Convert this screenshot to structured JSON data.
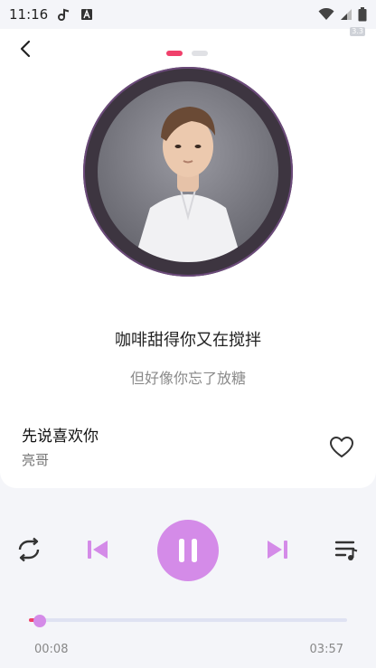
{
  "status_bar": {
    "time": "11:16",
    "left_icons": [
      "music-note-icon",
      "font-a-icon"
    ],
    "right_icons": [
      "wifi-icon",
      "signal-icon",
      "battery-icon"
    ]
  },
  "header": {
    "back_icon": "chevron-left-icon",
    "page_indicator": {
      "count": 2,
      "active": 0,
      "active_color": "#f0406b"
    },
    "corner_badge": "3.3"
  },
  "album_art": {
    "description_icon": "album-disc"
  },
  "lyrics": {
    "current": "咖啡甜得你又在搅拌",
    "next": "但好像你忘了放糖"
  },
  "song": {
    "title": "先说喜欢你",
    "artist": "亮哥",
    "favorite_icon": "heart-outline-icon"
  },
  "controls": {
    "repeat_icon": "repeat-icon",
    "prev_icon": "skip-previous-icon",
    "play_pause_icon": "pause-icon",
    "next_icon": "skip-next-icon",
    "playlist_icon": "playlist-icon",
    "accent_color": "#d48be8"
  },
  "progress": {
    "current_time": "00:08",
    "total_time": "03:57",
    "fraction": 0.034
  }
}
